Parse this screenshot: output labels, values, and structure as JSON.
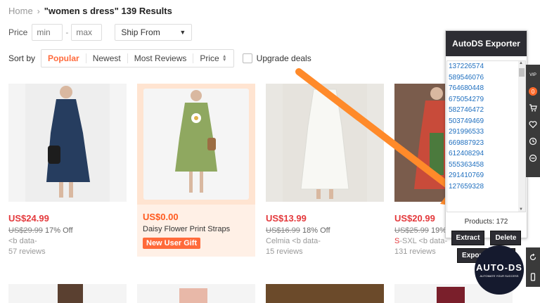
{
  "breadcrumb": {
    "home": "Home",
    "sep": "›",
    "query": "\"women s dress\" 139 Results"
  },
  "filters": {
    "price_label": "Price",
    "min_placeholder": "min",
    "dash": "-",
    "max_placeholder": "max",
    "ship_from": "Ship From"
  },
  "sort": {
    "label": "Sort by",
    "options": [
      "Popular",
      "Newest",
      "Most Reviews",
      "Price"
    ],
    "active": "Popular",
    "upgrade_label": "Upgrade deals"
  },
  "products": [
    {
      "price": "US$24.99",
      "old_price": "US$29.99",
      "discount": "17% Off",
      "line3": "<b data-",
      "reviews": "57 reviews",
      "color": "#233a5c"
    },
    {
      "price": "US$0.00",
      "name": "Daisy Flower Print Straps",
      "badge": "New User Gift",
      "color": "#8fa860"
    },
    {
      "price": "US$13.99",
      "old_price": "US$16.99",
      "discount": "18% Off",
      "line3": "Celmia <b data-",
      "reviews": "15 reviews",
      "color": "#f2f2ee"
    },
    {
      "price": "US$20.99",
      "old_price": "US$25.99",
      "discount": "19% O",
      "line3_hl": "S",
      "line3": "-SXL <b data-",
      "reviews": "131 reviews",
      "color": "#c84b3a"
    }
  ],
  "exporter": {
    "title": "AutoDS Exporter",
    "ids": [
      "137226574",
      "589546076",
      "764680448",
      "675054279",
      "582746472",
      "503749469",
      "291996533",
      "669887923",
      "612408294",
      "555363458",
      "291410769",
      "127659328"
    ],
    "count": "Products: 172",
    "extract": "Extract",
    "delete": "Delete",
    "export": "Export as CSV"
  },
  "rail": {
    "vip": "VIP",
    "cart_count": "0"
  },
  "logo": {
    "brand": "AUTO-DS",
    "tagline": "AUTOMATE YOUR SUCCESS"
  },
  "colors": {
    "accent": "#ff6b3d",
    "price": "#e4393c",
    "arrow": "#ff8a2a",
    "panel": "#2d2d33"
  }
}
